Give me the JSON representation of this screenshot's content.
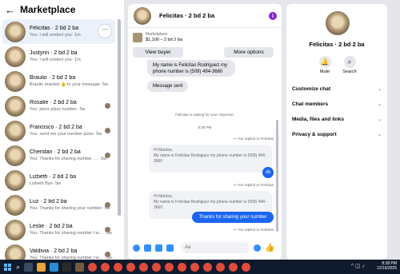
{
  "left_panel": {
    "title": "Marketplace",
    "back_icon": "back-arrow-icon",
    "conversations": [
      {
        "name": "Felicitas · 2 bd 2 ba",
        "preview": "You: I will contect you· 1m",
        "active": true
      },
      {
        "name": "Justynn · 2 bd 2 ba",
        "preview": "You: I will contect you· 1m"
      },
      {
        "name": "Braulio · 2 bd 2 ba",
        "preview": "Braulio reacted 👍 to your message· 5w"
      },
      {
        "name": "Rosalie · 2 bd 2 ba",
        "preview": "You: plzzz plzzz number· 5w"
      },
      {
        "name": "Francisco · 2 bd 2 ba",
        "preview": "You: send me your number plzzz· 5w"
      },
      {
        "name": "Cheridan · 2 bd 2 ba",
        "preview": "You: Thanks for sharing number ... · 5w"
      },
      {
        "name": "Lizbeth · 2 bd 2 ba",
        "preview": "Lizbeth Bye· 5w"
      },
      {
        "name": "Luz · 2 bd 2 ba",
        "preview": "You: Thanks for sharing your number· 5w"
      },
      {
        "name": "Leslie · 2 bd 2 ba",
        "preview": "You: Thanks for sharing number I w... · 5w"
      },
      {
        "name": "Valdivia · 2 bd 2 ba",
        "preview": "You: Thanks for sharing number I w... · 5w"
      }
    ]
  },
  "chat": {
    "title": "Felicitas · 2 bd 2 ba",
    "listing_label": "Marketplace",
    "listing_value": "$1,100 – 2 bd 2 ba",
    "view_buyer": "View buyer",
    "more_options": "More options",
    "msg_in_1": "My name is Felicitas Rodriguez my phone number is (509) 494-3660",
    "msg_in_2": "Message sent",
    "waiting": "Felicitas is waiting for your response.",
    "time": "8:38 PM",
    "replied_label": "You replied to Felicitas",
    "quote_1": "Hi Maritza,\nMy name is Felicitas Rodriguez my phone number is (509) 494-3660",
    "reply_1": "ok",
    "quote_2": "Hi Maritza,\nMy name is Felicitas Rodriguez my phone number is (509) 494-3660",
    "reply_2": "Thanks for sharing your number",
    "composer_placeholder": "Aa"
  },
  "profile": {
    "name": "Felicitas · 2 bd 2 ba",
    "mute_label": "Mute",
    "search_label": "Search",
    "sections": [
      "Customize chat",
      "Chat members",
      "Media, files and links",
      "Privacy & support"
    ]
  },
  "taskbar": {
    "time": "8:38 PM",
    "date": "12/16/2025"
  },
  "colors": {
    "accent": "#1a66f2",
    "info": "#8d1fd1",
    "taskbar": "#0f1a2c"
  }
}
